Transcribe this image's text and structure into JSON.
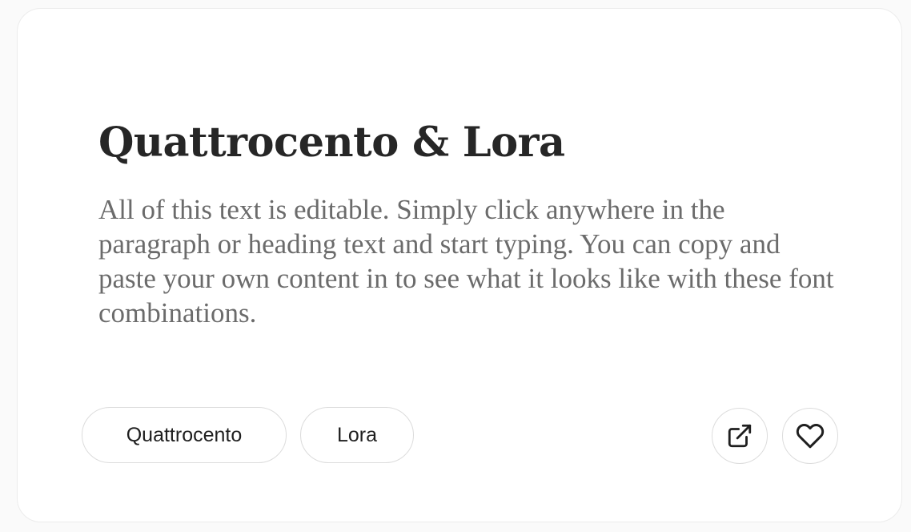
{
  "card": {
    "heading": "Quattrocento & Lora",
    "paragraph": "All of this text is editable. Simply click anywhere in the paragraph or heading text and start typing. You can copy and paste your own content in to see what it looks like with these font combinations.",
    "fonts": [
      {
        "label": "Quattrocento"
      },
      {
        "label": "Lora"
      }
    ],
    "actions": {
      "open_icon": "external-link-icon",
      "favorite_icon": "heart-icon"
    }
  },
  "colors": {
    "heading": "#262626",
    "paragraph": "#6b6b6b",
    "border": "#dcdcdc"
  }
}
